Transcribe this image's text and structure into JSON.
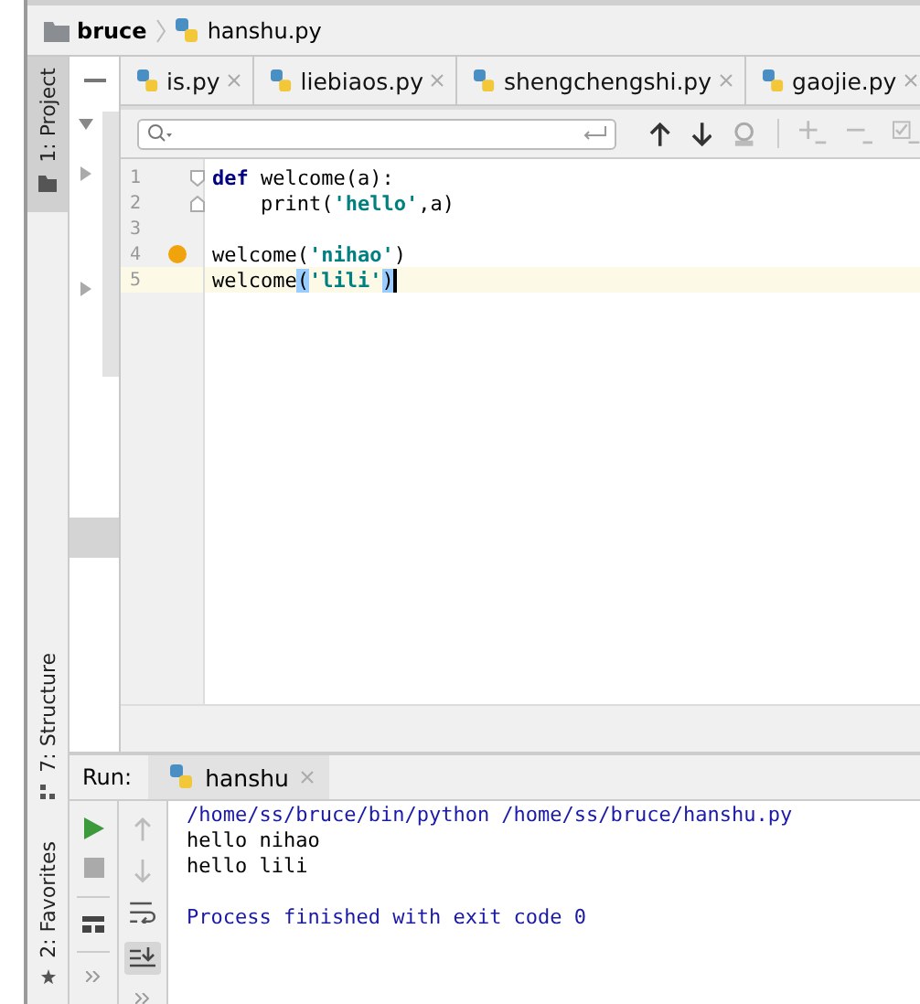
{
  "breadcrumb": [
    {
      "label": "bruce",
      "kind": "folder"
    },
    {
      "label": "hanshu.py",
      "kind": "file"
    }
  ],
  "tool_tabs": [
    {
      "label": "1: Project",
      "active": true,
      "kind": "folder"
    },
    {
      "label": "7: Structure",
      "active": false,
      "kind": "structure"
    },
    {
      "label": "2: Favorites",
      "active": false,
      "kind": "star"
    }
  ],
  "editor_tabs": [
    {
      "label": "is.py"
    },
    {
      "label": "liebiaos.py"
    },
    {
      "label": "shengchengshi.py"
    },
    {
      "label": "gaojie.py"
    }
  ],
  "code": {
    "lines": [
      {
        "number": "1",
        "current": false,
        "tokens": [
          {
            "kind": "keyword",
            "text": "def"
          },
          {
            "kind": "plain",
            "text": " welcome(a):"
          }
        ]
      },
      {
        "number": "2",
        "current": false,
        "tokens": [
          {
            "kind": "plain",
            "text": "    print("
          },
          {
            "kind": "string",
            "text": "'hello'"
          },
          {
            "kind": "plain",
            "text": ",a)"
          }
        ]
      },
      {
        "number": "3",
        "current": false
      },
      {
        "number": "4",
        "current": false,
        "tokens": [
          {
            "kind": "plain",
            "text": "welcome("
          },
          {
            "kind": "string",
            "text": "'nihao'"
          },
          {
            "kind": "plain",
            "text": ")"
          }
        ]
      },
      {
        "number": "5",
        "current": true,
        "tokens": [
          {
            "kind": "plain",
            "text": "welcome"
          },
          {
            "kind": "match",
            "text": "("
          },
          {
            "kind": "string",
            "text": "'lili'"
          },
          {
            "kind": "match",
            "text": ")"
          }
        ]
      }
    ]
  },
  "run": {
    "label": "Run:",
    "tab": "hanshu",
    "console": [
      {
        "kind": "command",
        "text": "/home/ss/bruce/bin/python /home/ss/bruce/hanshu.py"
      },
      {
        "kind": "output",
        "text": "hello nihao"
      },
      {
        "kind": "output",
        "text": "hello lili"
      },
      {
        "kind": "blank"
      },
      {
        "kind": "info",
        "text": "Process finished with exit code 0"
      }
    ]
  }
}
